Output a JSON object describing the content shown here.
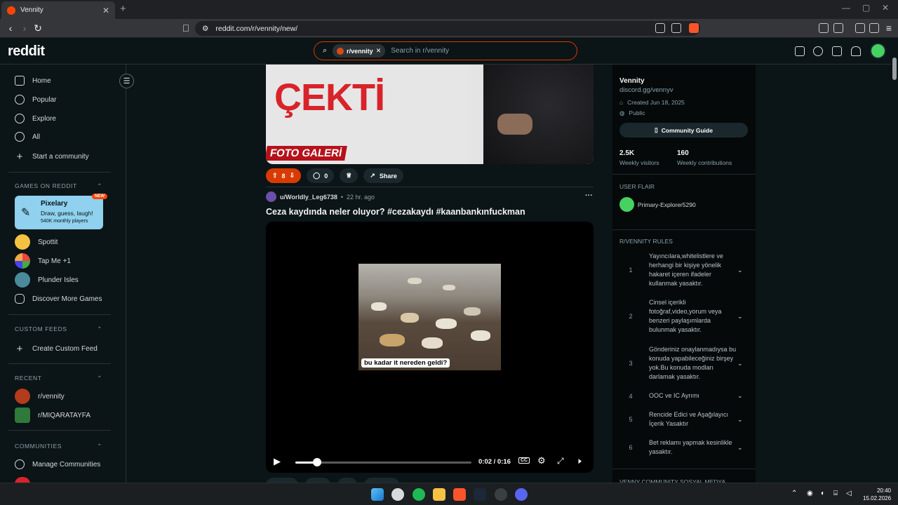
{
  "browser": {
    "tab_title": "Vennity",
    "tab_close": "✕",
    "new_tab": "+",
    "url": "reddit.com/r/vennity/new/"
  },
  "header": {
    "logo": "reddit",
    "search_chip": "r/vennity",
    "search_chip_close": "✕",
    "search_placeholder": "Search in r/vennity"
  },
  "sidebar": {
    "nav": [
      "Home",
      "Popular",
      "Explore",
      "All",
      "Start a community"
    ],
    "games_header": "GAMES ON REDDIT",
    "featured_game": {
      "title": "Pixelary",
      "subtitle": "Draw, guess, laugh!",
      "meta": "540K monthly players",
      "badge": "NEW"
    },
    "games": [
      "Spottit",
      "Tap Me +1",
      "Plunder Isles",
      "Discover More Games"
    ],
    "custom_header": "CUSTOM FEEDS",
    "custom_item": "Create Custom Feed",
    "recent_header": "RECENT",
    "recent": [
      "r/vennity",
      "r/MIQARATAYFA"
    ],
    "communities_header": "COMMUNITIES",
    "communities_item": "Manage Communities"
  },
  "post1": {
    "image_text_main": "ÇEKTİ",
    "image_text_banner": "FOTO GALERİ",
    "votes": "8",
    "comments": "0",
    "share": "Share"
  },
  "post2": {
    "author": "u/Worldly_Leg6738",
    "time": "22 hr. ago",
    "more": "···",
    "title": "Ceza kaydında neler oluyor? #cezakaydı #kaanbankınfuckman",
    "video_caption": "bu kadar it nereden geldi?",
    "time_display": "0:02 / 0:16",
    "progress": 0.125,
    "cc": "CC"
  },
  "right_sidebar": {
    "name": "Vennity",
    "link": "discord.gg/vennyv",
    "created": "Created Jun 18, 2025",
    "visibility": "Public",
    "guide_button": "Community Guide",
    "stats": [
      {
        "value": "2.5K",
        "label": "Weekly visitors"
      },
      {
        "value": "160",
        "label": "Weekly contributions"
      }
    ],
    "flair_header": "USER FLAIR",
    "flair_user": "Primary-Explorer5290",
    "rules_header": "R/VENNITY RULES",
    "rules": [
      {
        "n": "1",
        "text": "Yayıncılara,whitelistlere ve herhangi bir kişiye yönelik hakaret içeren ifadeler kullanmak yasaktır."
      },
      {
        "n": "2",
        "text": "Cinsel içerikli fotoğraf,video,yorum veya benzeri paylaşımlarda bulunmak yasaktır."
      },
      {
        "n": "3",
        "text": "Gönderiniz onaylanmadıysa bu konuda yapabileceğiniz birşey yok.Bu konuda modları darlamak yasaktır."
      },
      {
        "n": "4",
        "text": "OOC ve IC Ayrımı"
      },
      {
        "n": "5",
        "text": "Rencide Edici ve Aşağılayıcı İçerik Yasaktır"
      },
      {
        "n": "6",
        "text": "Bet reklamı yapmak kesinlikle yasaktır."
      }
    ],
    "bottom_header": "VENNY COMMUNITY SOSYAL MEDYA"
  },
  "taskbar": {
    "time": "20:40",
    "date": "15.02.2026"
  },
  "colors": {
    "accent": "#d93a00",
    "brand": "#ff4500",
    "bg": "#0b1416"
  }
}
